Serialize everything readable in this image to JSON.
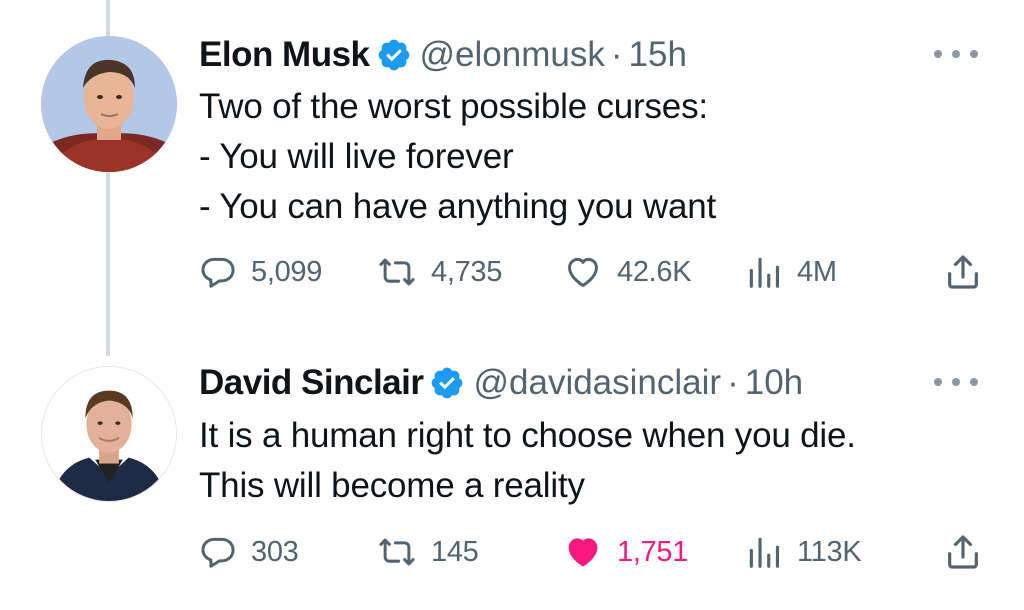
{
  "tweets": [
    {
      "author": "Elon Musk",
      "handle": "@elonmusk",
      "time": "15h",
      "lines": [
        "Two of the worst possible curses:",
        "- You will live forever",
        "- You can have anything you want"
      ],
      "replies": "5,099",
      "retweets": "4,735",
      "likes": "42.6K",
      "views": "4M",
      "liked": false
    },
    {
      "author": "David Sinclair",
      "handle": "@davidasinclair",
      "time": "10h",
      "lines": [
        "It is a human right to choose when you die.",
        "This will become a reality"
      ],
      "replies": "303",
      "retweets": "145",
      "likes": "1,751",
      "views": "113K",
      "liked": true
    }
  ],
  "colors": {
    "text": "#0f1419",
    "secondary": "#536471",
    "verified": "#1d9bf0",
    "like_active": "#f91880",
    "thread_line": "#cfd9de"
  },
  "icons": [
    "verified-badge-icon",
    "more-icon",
    "reply-icon",
    "retweet-icon",
    "like-icon",
    "views-icon",
    "share-icon"
  ]
}
